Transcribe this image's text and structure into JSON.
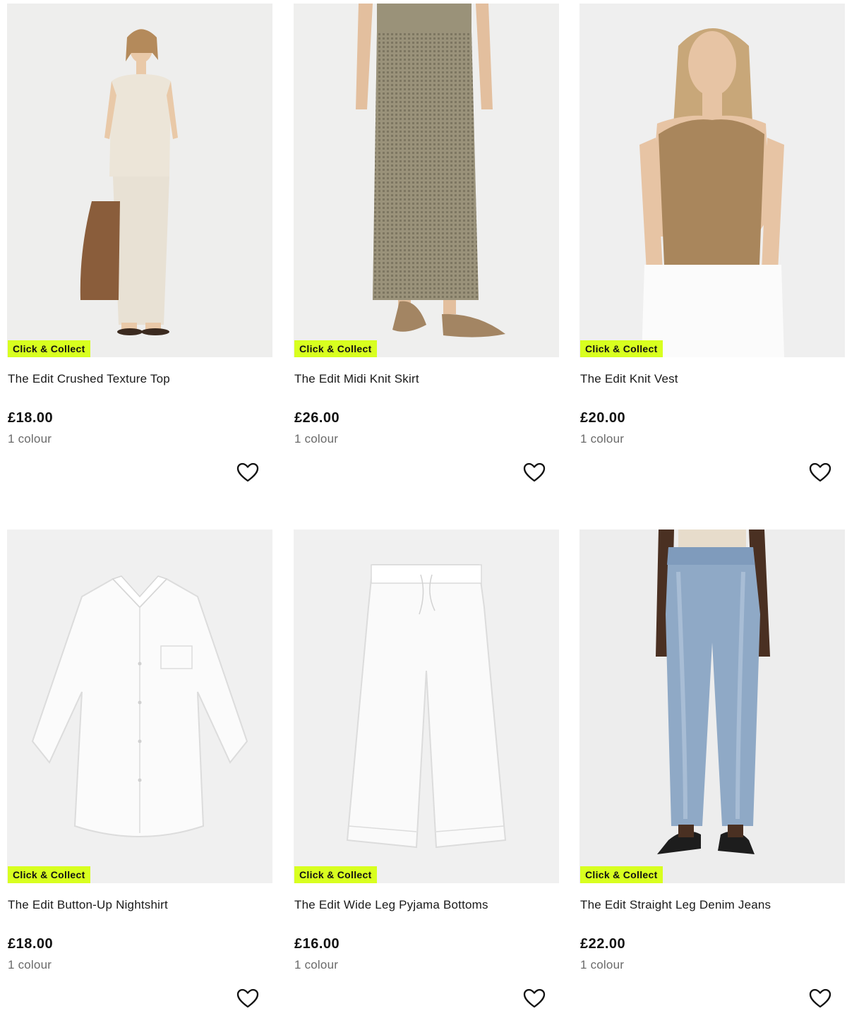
{
  "badge_color": "#d8ff1f",
  "products": [
    {
      "image": "model-crushed-texture-top-icon",
      "badge": "Click & Collect",
      "name": "The Edit Crushed Texture Top",
      "price": "£18.00",
      "colours": "1 colour"
    },
    {
      "image": "model-midi-knit-skirt-icon",
      "badge": "Click & Collect",
      "name": "The Edit Midi Knit Skirt",
      "price": "£26.00",
      "colours": "1 colour"
    },
    {
      "image": "model-knit-vest-icon",
      "badge": "Click & Collect",
      "name": "The Edit Knit Vest",
      "price": "£20.00",
      "colours": "1 colour"
    },
    {
      "image": "nightshirt-icon",
      "badge": "Click & Collect",
      "name": "The Edit Button-Up Nightshirt",
      "price": "£18.00",
      "colours": "1 colour"
    },
    {
      "image": "pyjama-bottoms-icon",
      "badge": "Click & Collect",
      "name": "The Edit Wide Leg Pyjama Bottoms",
      "price": "£16.00",
      "colours": "1 colour"
    },
    {
      "image": "model-denim-jeans-icon",
      "badge": "Click & Collect",
      "name": "The Edit Straight Leg Denim Jeans",
      "price": "£22.00",
      "colours": "1 colour"
    }
  ]
}
